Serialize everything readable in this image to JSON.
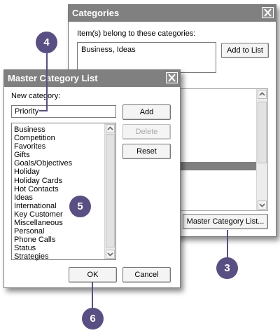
{
  "categories_dialog": {
    "title": "Categories",
    "prompt": "Item(s) belong to these categories:",
    "assigned_value": "Business, Ideas",
    "add_to_list_label": "Add to List",
    "master_list_button_label": "Master Category List..."
  },
  "master_dialog": {
    "title": "Master Category List",
    "new_category_label": "New category:",
    "new_category_value": "Priority",
    "add_label": "Add",
    "delete_label": "Delete",
    "reset_label": "Reset",
    "ok_label": "OK",
    "cancel_label": "Cancel",
    "items": [
      "Business",
      "Competition",
      "Favorites",
      "Gifts",
      "Goals/Objectives",
      "Holiday",
      "Holiday Cards",
      "Hot Contacts",
      "Ideas",
      "International",
      "Key Customer",
      "Miscellaneous",
      "Personal",
      "Phone Calls",
      "Status",
      "Strategies"
    ]
  },
  "callouts": [
    "4",
    "5",
    "3",
    "6"
  ],
  "colors": {
    "callout": "#5a4f82",
    "titlebar": "#808080",
    "selection": "#808080"
  }
}
